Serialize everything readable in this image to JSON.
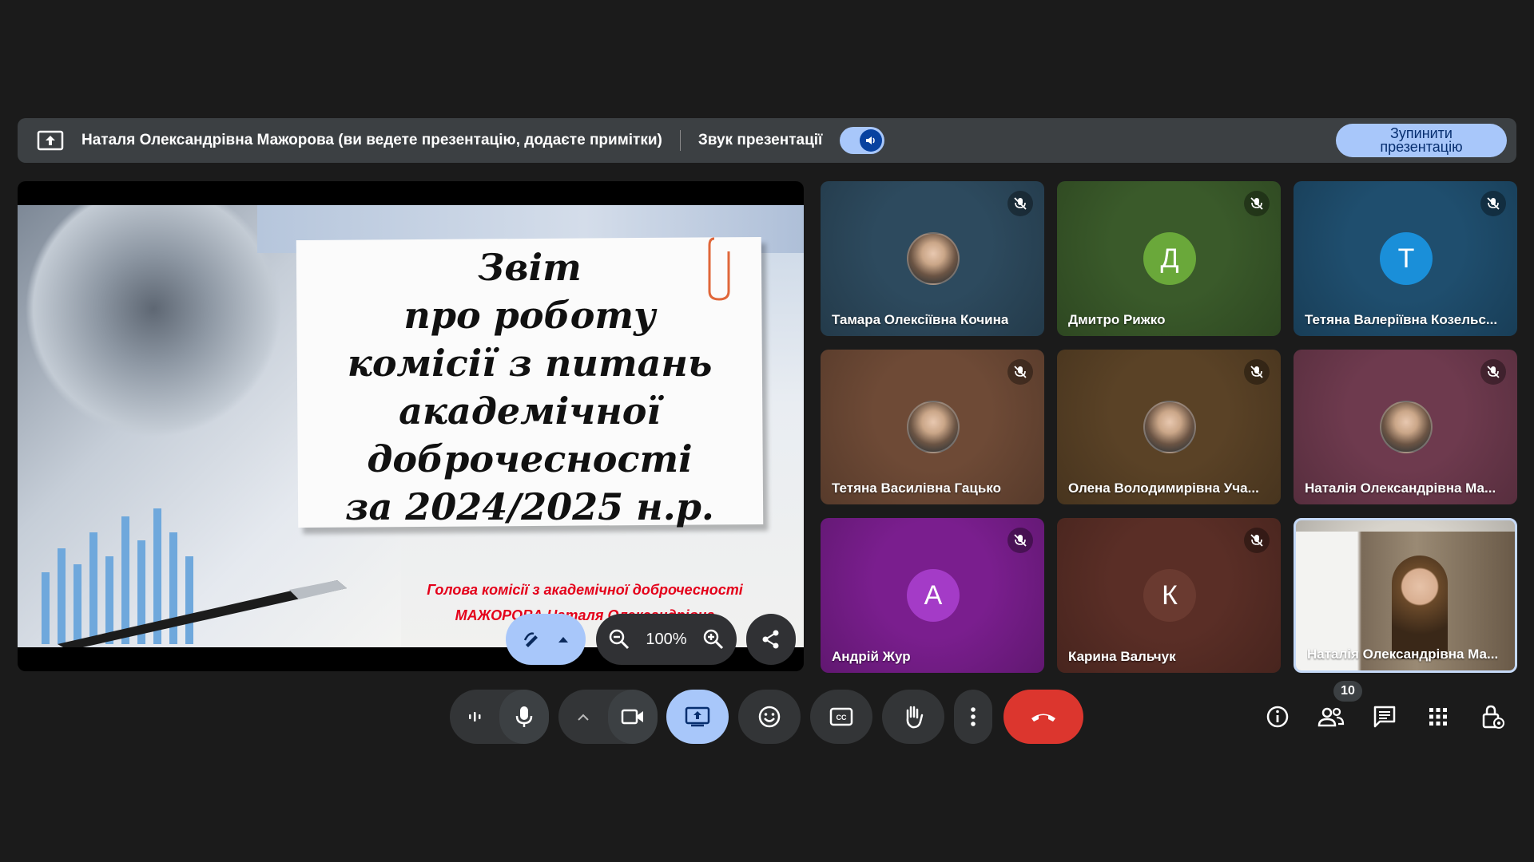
{
  "banner": {
    "presenter_text": "Наталя Олександрівна Мажорова (ви ведете презентацію, додаєте примітки)",
    "audio_label": "Звук презентації",
    "stop_button": "Зупинити презентацію",
    "audio_on": true
  },
  "slide": {
    "title_lines": [
      "Звіт",
      "про роботу",
      "комісії з питань",
      "академічної",
      "доброчесності",
      "за  2024/2025 н.р."
    ],
    "subtitle_lines": [
      "Голова комісії з академічної доброчесності",
      "МАЖОРОВА Наталя Олександрівна"
    ],
    "zoom_level": "100%"
  },
  "participants": [
    {
      "name": "Тамара Олексіївна Кочина",
      "initial": "",
      "muted": true,
      "bg": "#2d4a5e",
      "avatar_type": "photo"
    },
    {
      "name": "Дмитро Рижко",
      "initial": "Д",
      "muted": true,
      "bg": "#3a5a2a",
      "avatar_color": "#6aa83a",
      "avatar_type": "letter"
    },
    {
      "name": "Тетяна Валеріївна Козельс...",
      "initial": "Т",
      "muted": true,
      "bg": "#1f4e6e",
      "avatar_color": "#1a8fd9",
      "avatar_type": "letter"
    },
    {
      "name": "Тетяна Василівна Гацько",
      "initial": "",
      "muted": true,
      "bg": "#6e4a36",
      "avatar_type": "photo"
    },
    {
      "name": "Олена Володимирівна Уча...",
      "initial": "",
      "muted": true,
      "bg": "#5a4226",
      "avatar_type": "photo"
    },
    {
      "name": "Наталія Олександрівна Ма...",
      "initial": "",
      "muted": true,
      "bg": "#6e3a4e",
      "avatar_type": "photo"
    },
    {
      "name": "Андрій Жур",
      "initial": "А",
      "muted": true,
      "bg": "#7a1e8e",
      "avatar_color": "#a43bc7",
      "avatar_type": "letter"
    },
    {
      "name": "Карина Вальчук",
      "initial": "К",
      "muted": true,
      "bg": "#5a2e26",
      "avatar_color": "#6a3a30",
      "avatar_type": "letter"
    },
    {
      "name": "Наталія Олександрівна Ма...",
      "initial": "",
      "muted": false,
      "bg": "#d8d4cc",
      "avatar_type": "video"
    }
  ],
  "people_count": "10",
  "colors": {
    "accent": "#a8c7fa",
    "end_call": "#dc362e",
    "banner": "#3c4043",
    "control": "#333537"
  },
  "icons": {
    "present": "present-to-all-icon",
    "mic": "mic-icon",
    "camera": "videocam-icon",
    "emoji": "emoji-icon",
    "captions": "closed-caption-icon",
    "hand": "raise-hand-icon",
    "more": "more-vert-icon",
    "end": "call-end-icon",
    "info": "info-icon",
    "people": "people-icon",
    "chat": "chat-icon",
    "activities": "apps-icon",
    "host": "host-controls-icon"
  }
}
